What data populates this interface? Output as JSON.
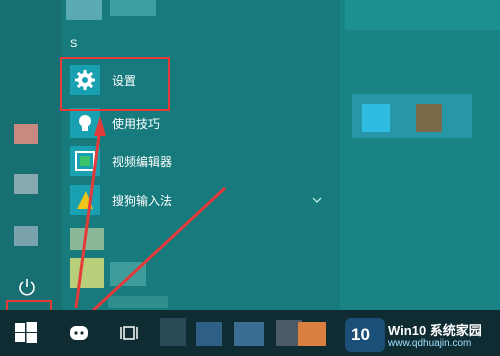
{
  "section_letter": "S",
  "apps": [
    {
      "label": "设置",
      "icon": "gear-icon"
    },
    {
      "label": "使用技巧",
      "icon": "lightbulb-icon"
    },
    {
      "label": "视频编辑器",
      "icon": "film-icon"
    },
    {
      "label": "搜狗输入法",
      "icon": "sogou-icon"
    }
  ],
  "expand_icon": "chevron-down-icon",
  "taskbar": {
    "start_icon": "windows-logo-icon",
    "cortana_icon": "cortana-icon",
    "taskview_icon": "task-view-icon"
  },
  "watermark": {
    "logo_text": "10",
    "brand": "Win10 系统家园",
    "url": "www.qdhuajin.com"
  },
  "colors": {
    "highlight": "#e33a3a",
    "app_tile": "#19a0b1"
  }
}
